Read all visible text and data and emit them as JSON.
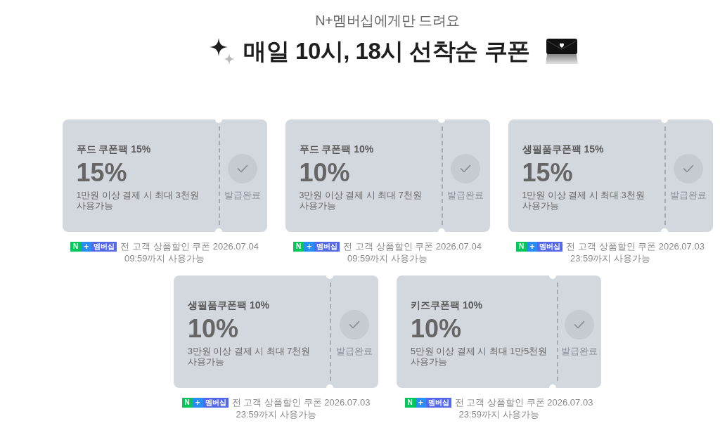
{
  "header": {
    "subtitle": "N+멤버십에게만 드려요",
    "title": "매일 10시, 18시 선착순 쿠폰"
  },
  "coupons": [
    {
      "title": "푸드 쿠폰팩 15%",
      "discount": "15%",
      "description": [
        "1만원 이상 결제 시 최대 3천원",
        "사용가능"
      ],
      "status": "발급완료",
      "issued": true,
      "badge": [
        {
          "kind": "logo",
          "text": "N",
          "color": "#03c75a"
        },
        {
          "kind": "plus",
          "text": "+",
          "color": "#2a8cf5"
        },
        {
          "kind": "label",
          "text": "멤버십",
          "color": "#5468e8"
        }
      ],
      "note": [
        "전 고객 상품할인 쿠폰 2026.07.04",
        "09:59까지 사용가능"
      ]
    },
    {
      "title": "푸드 쿠폰팩 10%",
      "discount": "10%",
      "description": [
        "3만원 이상 결제 시 최대 7천원",
        "사용가능"
      ],
      "status": "발급완료",
      "issued": true,
      "badge": [
        {
          "kind": "logo",
          "text": "N",
          "color": "#03c75a"
        },
        {
          "kind": "plus",
          "text": "+",
          "color": "#2a8cf5"
        },
        {
          "kind": "label",
          "text": "멤버십",
          "color": "#5468e8"
        }
      ],
      "note": [
        "전 고객 상품할인 쿠폰 2026.07.04",
        "09:59까지 사용가능"
      ]
    },
    {
      "title": "생필품쿠폰팩 15%",
      "discount": "15%",
      "description": [
        "1만원 이상 결제 시 최대 3천원",
        "사용가능"
      ],
      "status": "발급완료",
      "issued": true,
      "badge": [
        {
          "kind": "logo",
          "text": "N",
          "color": "#03c75a"
        },
        {
          "kind": "plus",
          "text": "+",
          "color": "#2a8cf5"
        },
        {
          "kind": "label",
          "text": "멤버십",
          "color": "#5468e8"
        }
      ],
      "note": [
        "전 고객 상품할인 쿠폰 2026.07.03",
        "23:59까지 사용가능"
      ]
    },
    {
      "title": "생필품쿠폰팩 10%",
      "discount": "10%",
      "description": [
        "3만원 이상 결제 시 최대 7천원",
        "사용가능"
      ],
      "status": "발급완료",
      "issued": true,
      "badge": [
        {
          "kind": "logo",
          "text": "N",
          "color": "#03c75a"
        },
        {
          "kind": "plus",
          "text": "+",
          "color": "#2a8cf5"
        },
        {
          "kind": "label",
          "text": "멤버십",
          "color": "#5468e8"
        }
      ],
      "note": [
        "전 고객 상품할인 쿠폰 2026.07.03",
        "23:59까지 사용가능"
      ]
    },
    {
      "title": "키즈쿠폰팩 10%",
      "discount": "10%",
      "description": [
        "5만원 이상 결제 시 최대 1만5천원",
        "사용가능"
      ],
      "status": "발급완료",
      "issued": true,
      "badge": [
        {
          "kind": "logo",
          "text": "N",
          "color": "#03c75a"
        },
        {
          "kind": "plus",
          "text": "+",
          "color": "#2a8cf5"
        },
        {
          "kind": "label",
          "text": "멤버십",
          "color": "#5468e8"
        }
      ],
      "note": [
        "전 고객 상품할인 쿠폰 2026.07.03",
        "23:59까지 사용가능"
      ]
    }
  ]
}
